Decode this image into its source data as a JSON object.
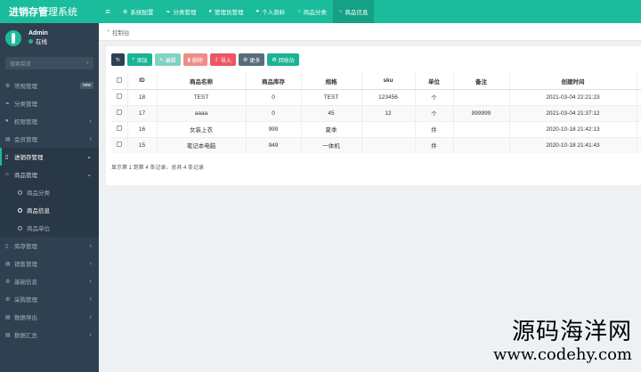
{
  "app": {
    "title_bold": "进销存管",
    "title_rest": "理系统"
  },
  "topnav": {
    "toggle_icon": "menu-icon",
    "items": [
      {
        "label": "系统配置",
        "icon": "gear-icon"
      },
      {
        "label": "分类管理",
        "icon": "leaf-icon"
      },
      {
        "label": "管理员管理",
        "icon": "user-icon"
      },
      {
        "label": "个人资料",
        "icon": "user-icon"
      },
      {
        "label": "商品分类",
        "icon": "circle-icon"
      },
      {
        "label": "商品信息",
        "icon": "circle-icon"
      }
    ]
  },
  "user": {
    "name": "Admin",
    "status": "在线"
  },
  "search": {
    "placeholder": "搜索菜单"
  },
  "sidebar": {
    "items": [
      {
        "label": "常规管理",
        "badge": "new"
      },
      {
        "label": "分类管理"
      },
      {
        "label": "权限管理"
      },
      {
        "label": "会员管理"
      },
      {
        "label": "进销存管理"
      },
      {
        "label": "商品管理"
      },
      {
        "label": "商品分类"
      },
      {
        "label": "商品信息"
      },
      {
        "label": "商品单位"
      },
      {
        "label": "库存管理"
      },
      {
        "label": "销售管理"
      },
      {
        "label": "基础信息"
      },
      {
        "label": "采购管理"
      },
      {
        "label": "数据导出"
      },
      {
        "label": "数据汇总"
      }
    ]
  },
  "breadcrumb": {
    "label": "控制台"
  },
  "toolbar": {
    "add": "添加",
    "edit": "编辑",
    "delete": "删除",
    "import": "导入",
    "more": "更多",
    "recycle": "回收站"
  },
  "table": {
    "headers": [
      "ID",
      "商品名称",
      "商品库存",
      "规格",
      "sku",
      "单位",
      "备注",
      "创建时间"
    ],
    "rows": [
      [
        "18",
        "TEST",
        "0",
        "TEST",
        "123456",
        "个",
        "",
        "2021-03-04 22:21:23"
      ],
      [
        "17",
        "aaaa",
        "0",
        "45",
        "12",
        "个",
        "999999",
        "2021-03-04 21:37:12"
      ],
      [
        "16",
        "女装上衣",
        "999",
        "夏季",
        "",
        "件",
        "",
        "2020-10-18 21:42:13"
      ],
      [
        "15",
        "笔记本电脑",
        "949",
        "一体机",
        "",
        "件",
        "",
        "2020-10-18 21:41:43"
      ]
    ]
  },
  "pagination": {
    "info": "显示第 1 到第 4 条记录，总共 4 条记录"
  },
  "watermark": {
    "line1": "源码海洋网",
    "line2": "www.codehy.com"
  },
  "colors": {
    "accent": "#1abc9c",
    "sidebar": "#2f4050"
  }
}
